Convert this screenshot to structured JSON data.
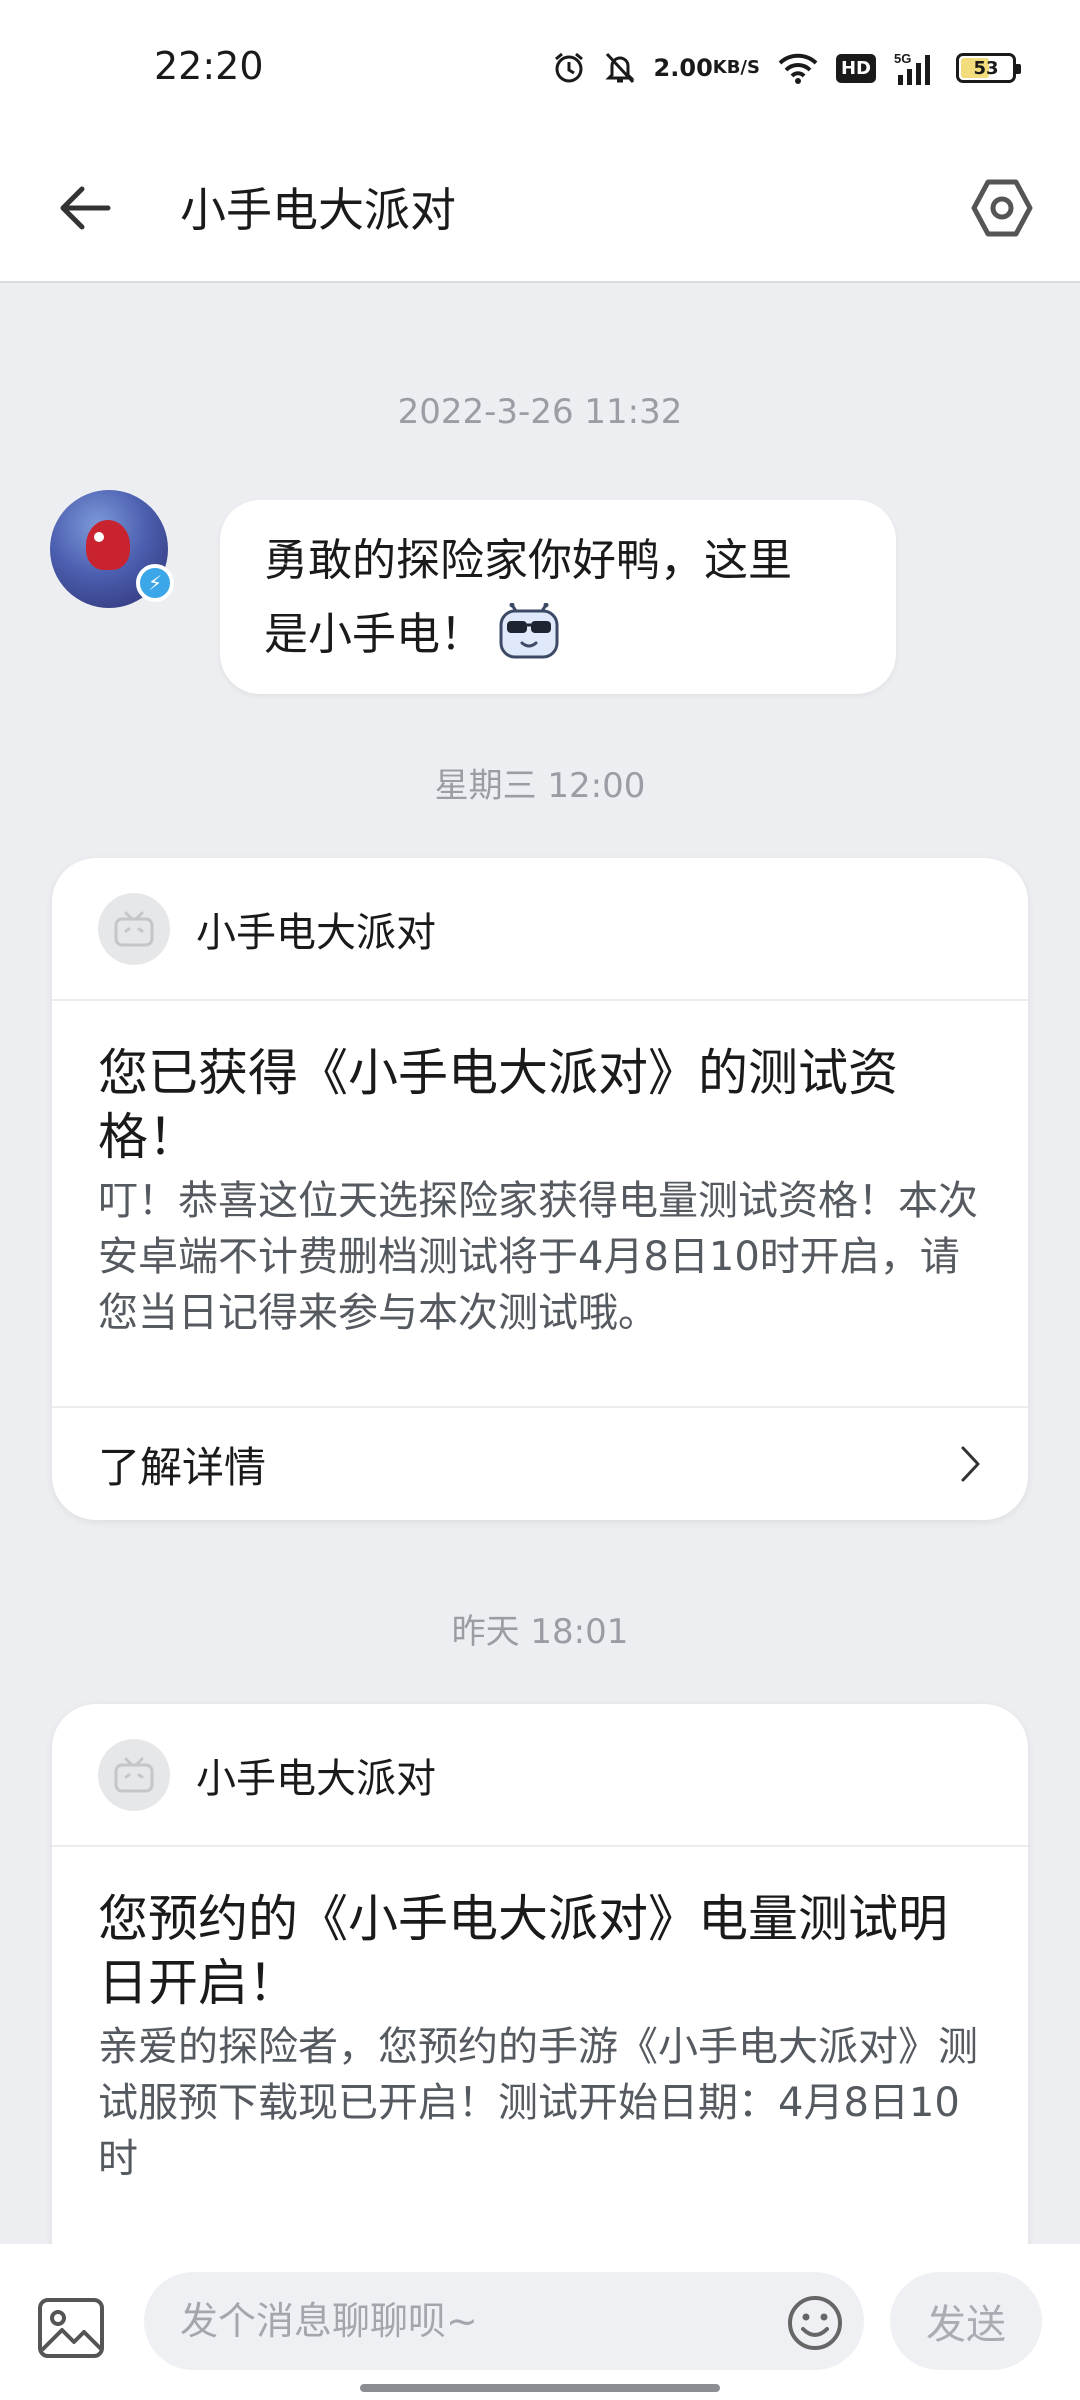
{
  "status_bar": {
    "time": "22:20",
    "net_speed_value": "2.00",
    "net_speed_unit": "KB/S",
    "hd_label": "HD",
    "network_label": "5G",
    "battery_level": "53",
    "battery_fraction": 0.53,
    "icons": [
      "alarm-icon",
      "mute-bell-icon",
      "wifi-icon",
      "hd-icon",
      "signal-5g-icon",
      "battery-icon"
    ]
  },
  "header": {
    "title": "小手电大派对",
    "back_icon": "back-arrow-icon",
    "settings_icon": "settings-hexagon-icon"
  },
  "chat": {
    "timestamps": [
      "2022-3-26 11:32",
      "星期三 12:00",
      "昨天 18:01"
    ],
    "greeting": {
      "line1": "勇敢的探险家你好鸭，这里",
      "line2": "是小手电！",
      "emoji": "sunglasses-robot-emoji"
    },
    "cards": [
      {
        "source": "小手电大派对",
        "title": "您已获得《小手电大派对》的测试资格！",
        "text": "叮！恭喜这位天选探险家获得电量测试资格！本次安卓端不计费删档测试将于4月8日10时开启，请您当日记得来参与本次测试哦。",
        "link": "了解详情"
      },
      {
        "source": "小手电大派对",
        "title": "您预约的《小手电大派对》电量测试明日开启！",
        "text": "亲爱的探险者，您预约的手游《小手电大派对》测试服预下载现已开启！测试开始日期：4月8日10时"
      }
    ]
  },
  "input_bar": {
    "placeholder": "发个消息聊聊呗~",
    "send_label": "发送",
    "image_icon": "image-icon",
    "emoji_icon": "smiley-icon"
  },
  "colors": {
    "background": "#eceef1",
    "card": "#ffffff",
    "muted_text": "#9a9ea4",
    "badge": "#3ba7e8"
  }
}
